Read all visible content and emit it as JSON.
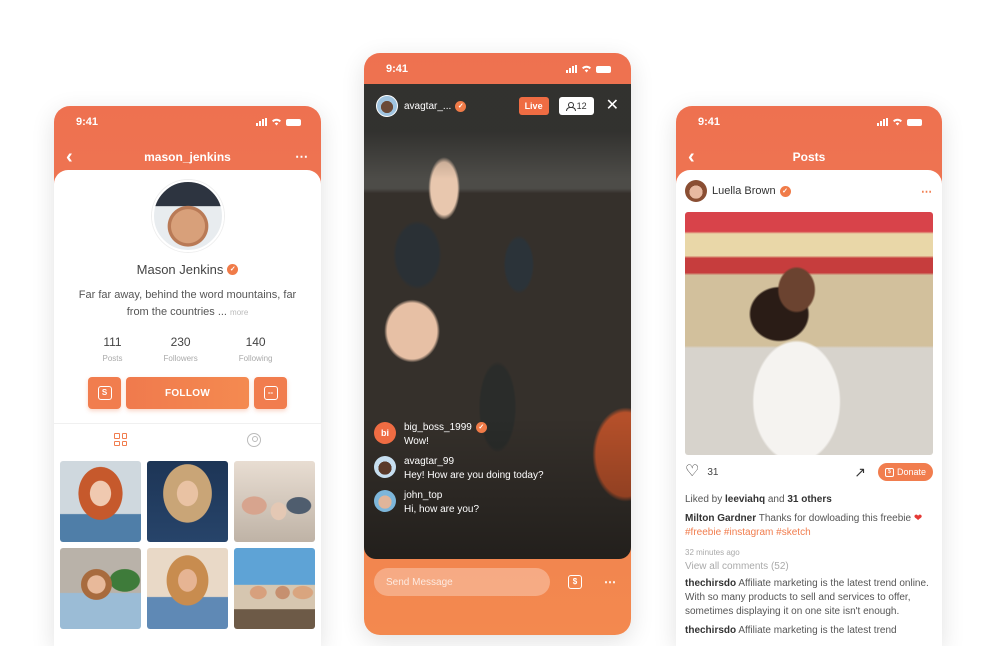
{
  "theme": {
    "accent": "#f17d4e",
    "header_gradient": [
      "#ee7150",
      "#f1845a"
    ]
  },
  "status_bar": {
    "time": "9:41"
  },
  "profile": {
    "back_icon": "chevron-left-icon",
    "username": "mason_jenkins",
    "more_icon": "ellipsis-icon",
    "name": "Mason Jenkins",
    "verified_icon": "verified-badge-icon",
    "bio": "Far far away, behind the word mountains, far from the countries ...",
    "bio_more": "more",
    "stats": [
      {
        "value": "111",
        "label": "Posts"
      },
      {
        "value": "230",
        "label": "Followers"
      },
      {
        "value": "140",
        "label": "Following"
      }
    ],
    "donate_glyph": "S",
    "follow_label": "FOLLOW",
    "message_glyph": "--",
    "tabs": [
      {
        "icon": "grid-icon",
        "active": true
      },
      {
        "icon": "tagged-person-icon",
        "active": false
      }
    ],
    "photos": [
      "red-haired woman portrait",
      "blonde curly-haired woman portrait",
      "children on beach",
      "woman seated at desk",
      "woman in denim jacket",
      "friends jumping on beach"
    ]
  },
  "live": {
    "host": "avagtar_...",
    "live_label": "Live",
    "viewer_count": "12",
    "close_icon": "close-icon",
    "comments": [
      {
        "avatar_initials": "bi",
        "user": "big_boss_1999",
        "verified": true,
        "text": "Wow!"
      },
      {
        "avatar_initials": "",
        "user": "avagtar_99",
        "verified": false,
        "text": "Hey! How are you doing today?"
      },
      {
        "avatar_initials": "",
        "user": "john_top",
        "verified": false,
        "text": "Hi, how are you?"
      }
    ],
    "message_placeholder": "Send Message",
    "donate_glyph": "$",
    "more_icon": "ellipsis-icon"
  },
  "posts": {
    "title": "Posts",
    "author": "Luella Brown",
    "likes": "31",
    "donate_label": "Donate",
    "donate_glyph": "$",
    "liked_by_prefix": "Liked by",
    "liked_by_user": "leeviahq",
    "liked_by_and": "and",
    "liked_by_others": "31 others",
    "caption_user": "Milton Gardner",
    "caption_text": "Thanks for dowloading this freebie",
    "caption_emoji": "❤",
    "hashtags": [
      "#freebie",
      "#instagram",
      "#sketch"
    ],
    "timestamp": "32 minutes ago",
    "view_all": "View all comments (52)",
    "comments": [
      {
        "user": "thechirsdo",
        "text": "Affiliate marketing is the latest trend online. With so many products to sell and services to offer, sometimes displaying it on one site isn't enough."
      },
      {
        "user": "thechirsdo",
        "text": "Affiliate marketing is the latest trend"
      }
    ]
  }
}
